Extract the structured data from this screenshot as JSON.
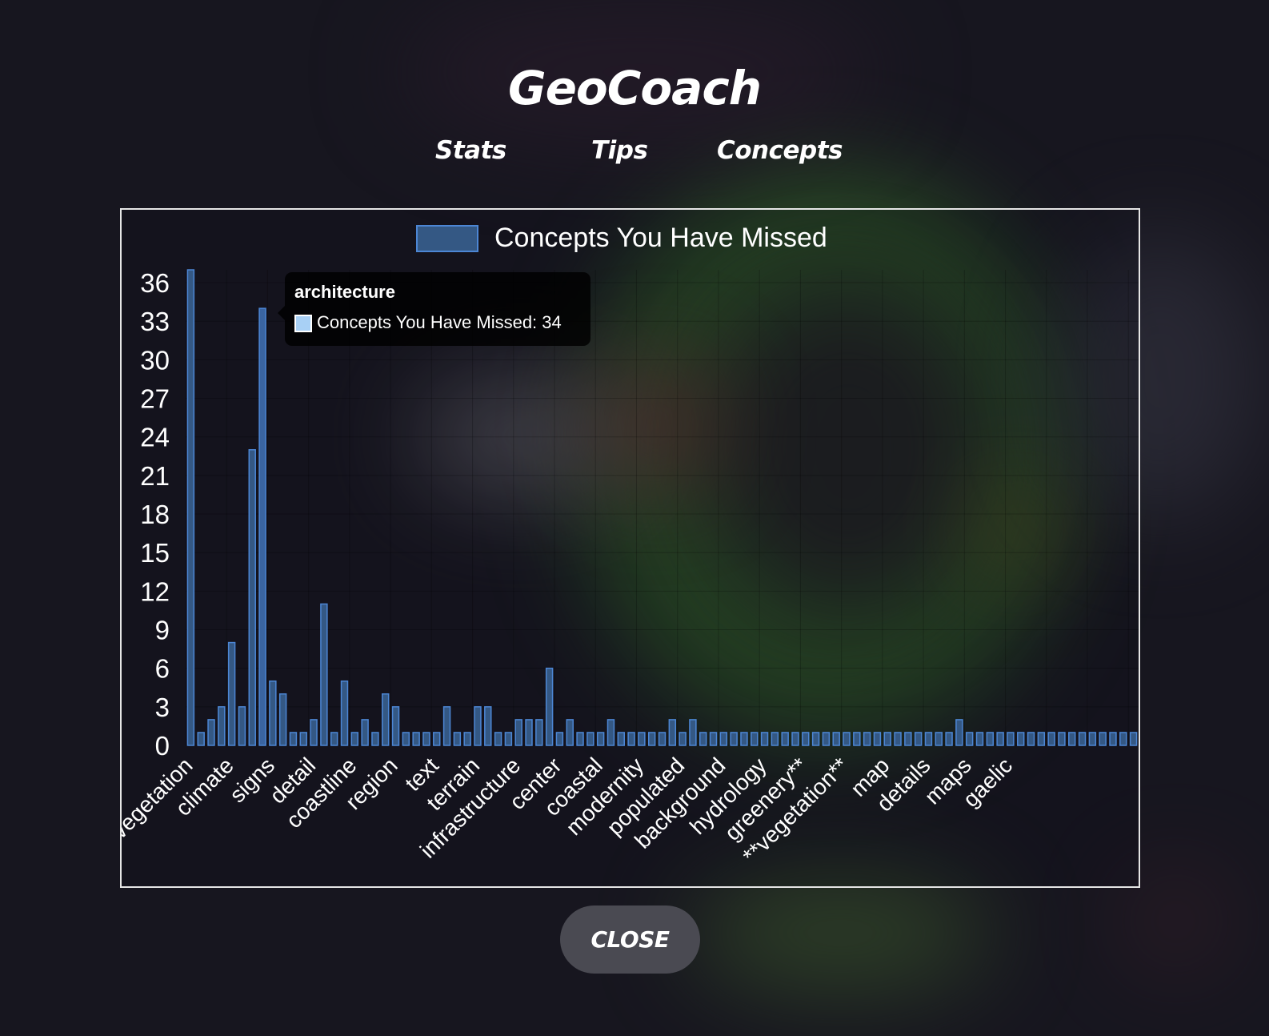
{
  "app": {
    "title": "GeoCoach"
  },
  "nav": {
    "tabs": [
      {
        "label": "Stats"
      },
      {
        "label": "Tips"
      },
      {
        "label": "Concepts"
      }
    ]
  },
  "tooltip": {
    "title": "architecture",
    "text": "Concepts You Have Missed: 34",
    "swatch_color": "#a8d0f5"
  },
  "close_button": {
    "label": "CLOSE"
  },
  "colors": {
    "bar_fill": "#345884",
    "bar_border": "#4c86d4",
    "bar_highlight_fill": "#3a64a0"
  },
  "chart_data": {
    "type": "bar",
    "title": "",
    "xlabel": "",
    "ylabel": "",
    "ylim": [
      0,
      37
    ],
    "y_ticks": [
      0,
      3,
      6,
      9,
      12,
      15,
      18,
      21,
      24,
      27,
      30,
      33,
      36
    ],
    "grid": true,
    "legend_position": "top-center",
    "highlighted_index": 7,
    "series": [
      {
        "name": "Concepts You Have Missed"
      }
    ],
    "categories": [
      "vegetation",
      "",
      "",
      "",
      "climate",
      "",
      "",
      "",
      "signs",
      "",
      "",
      "",
      "detail",
      "",
      "",
      "",
      "coastline",
      "",
      "",
      "",
      "region",
      "",
      "",
      "",
      "text",
      "",
      "",
      "",
      "terrain",
      "",
      "",
      "",
      "infrastructure",
      "",
      "",
      "",
      "center",
      "",
      "",
      "",
      "coastal",
      "",
      "",
      "",
      "modernity",
      "",
      "",
      "",
      "populated",
      "",
      "",
      "",
      "background",
      "",
      "",
      "",
      "hydrology",
      "",
      "",
      "",
      "greenery**",
      "",
      "",
      "",
      "**vegetation**",
      "",
      "",
      "",
      "map",
      "",
      "",
      "",
      "details",
      "",
      "",
      "",
      "maps",
      "",
      "",
      "",
      "gaelic",
      "",
      "",
      ""
    ],
    "values": [
      37,
      1,
      2,
      3,
      8,
      3,
      23,
      34,
      5,
      4,
      1,
      1,
      2,
      11,
      1,
      5,
      1,
      2,
      1,
      4,
      3,
      1,
      1,
      1,
      1,
      3,
      1,
      1,
      3,
      3,
      1,
      1,
      2,
      2,
      2,
      6,
      1,
      2,
      1,
      1,
      1,
      2,
      1,
      1,
      1,
      1,
      1,
      2,
      1,
      2,
      1,
      1,
      1,
      1,
      1,
      1,
      1,
      1,
      1,
      1,
      1,
      1,
      1,
      1,
      1,
      1,
      1,
      1,
      1,
      1,
      1,
      1,
      1,
      1,
      1,
      2,
      1,
      1,
      1,
      1,
      1,
      1,
      1,
      1,
      1,
      1,
      1,
      1,
      1,
      1,
      1,
      1,
      1
    ]
  }
}
